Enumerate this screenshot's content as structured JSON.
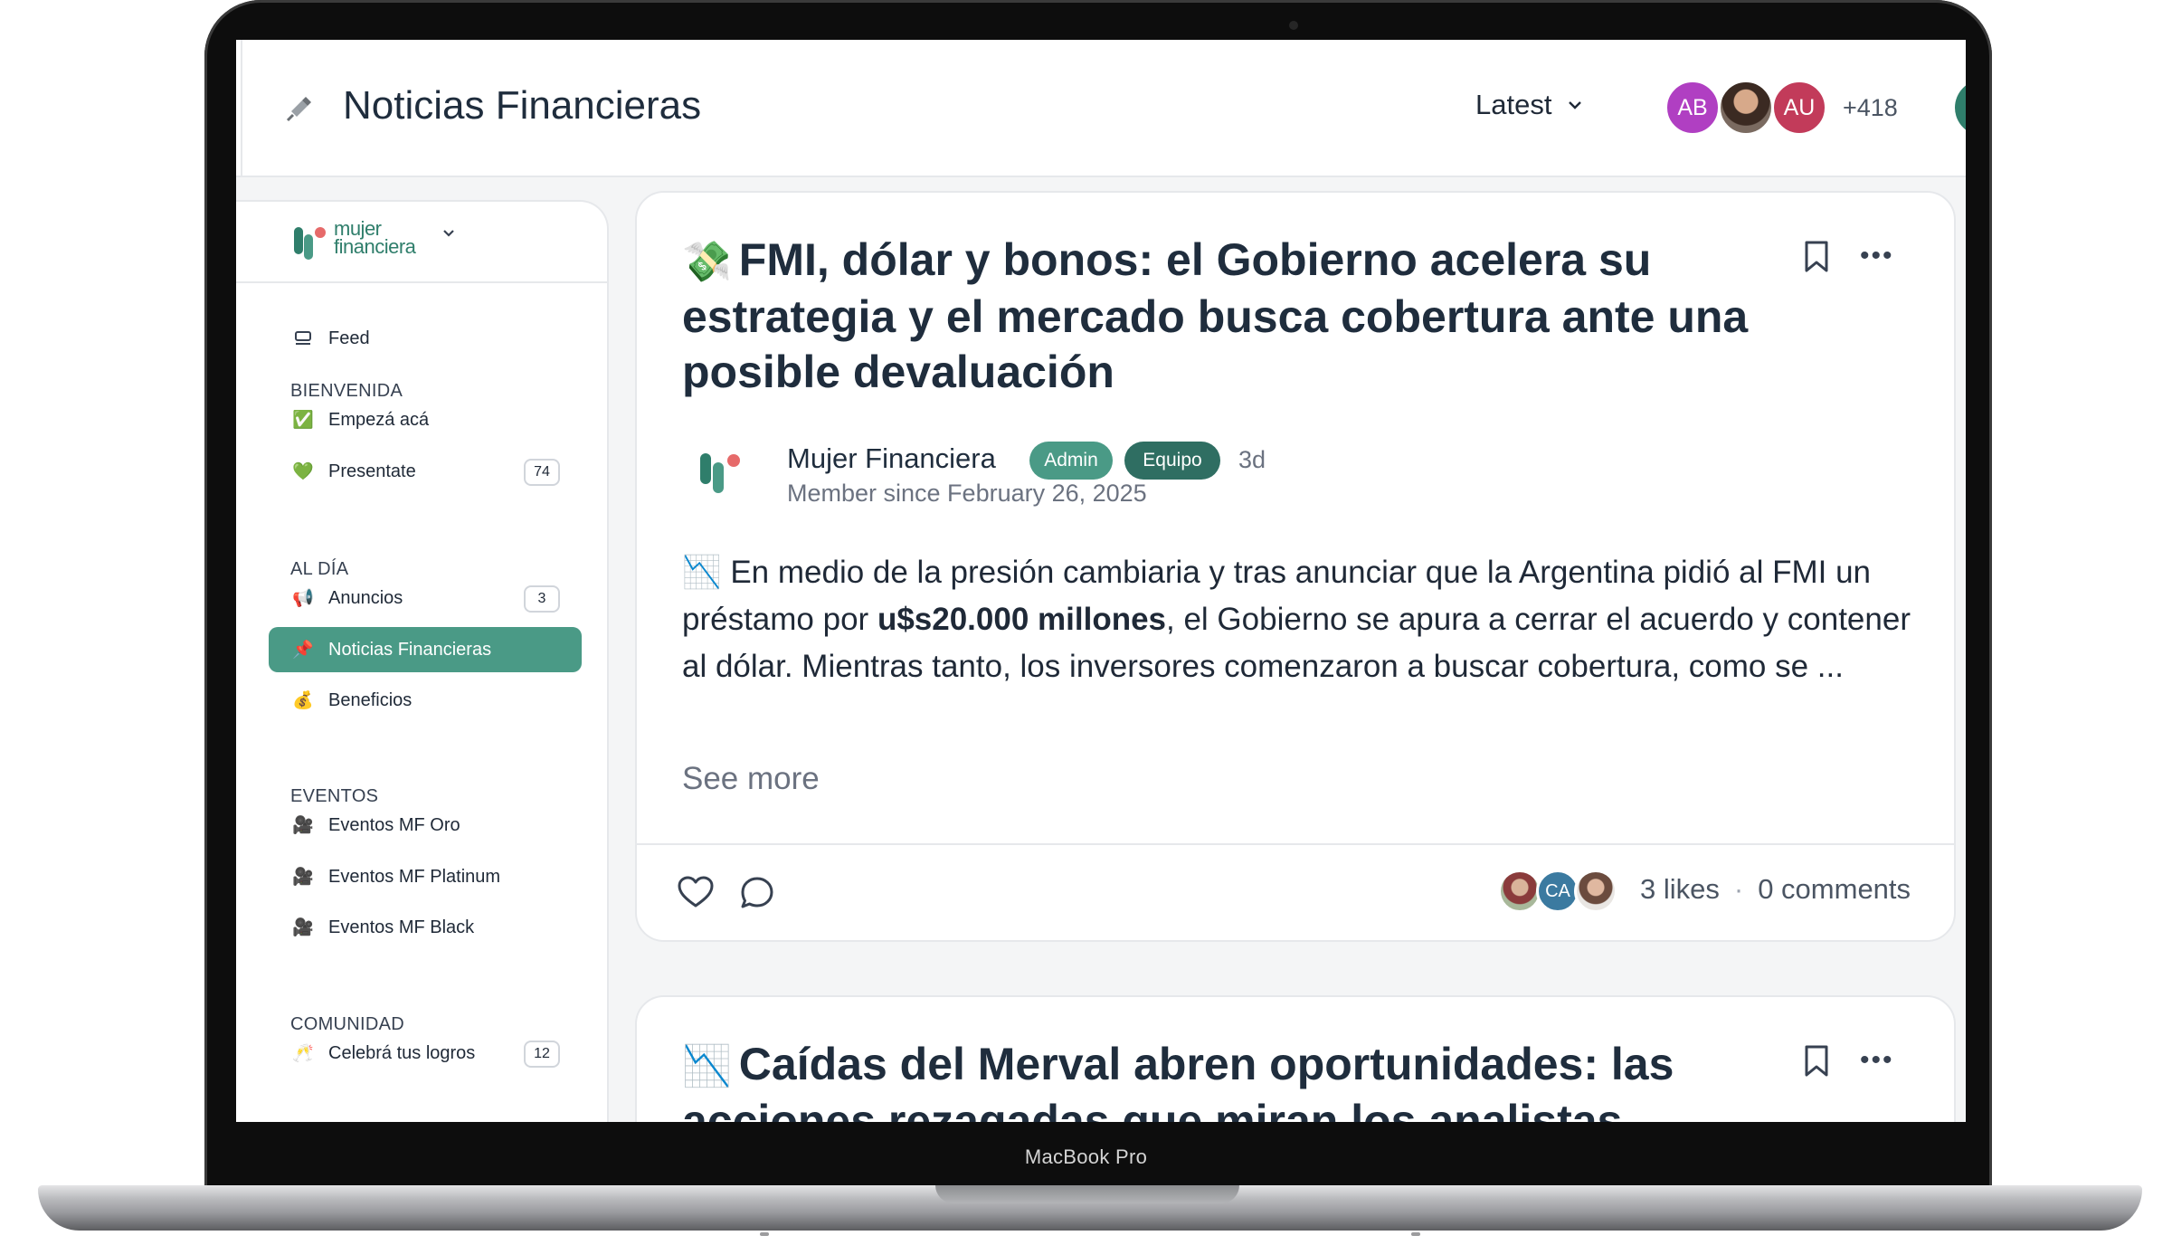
{
  "device": {
    "label": "MacBook Pro"
  },
  "header": {
    "title": "Noticias Financieras",
    "title_icon": "pushpin-icon",
    "sort": {
      "label": "Latest",
      "icon": "chevron-down-icon"
    },
    "avatars": [
      {
        "initials": "AB",
        "color": "#b03fc2"
      },
      {
        "initials": "",
        "photo": true
      },
      {
        "initials": "AU",
        "color": "#c23b5a"
      }
    ],
    "member_count": "+418"
  },
  "sidebar": {
    "brand": {
      "line1": "mujer",
      "line2": "financiera",
      "mark": "·"
    },
    "feed_label": "Feed",
    "sections": [
      {
        "label": "BIENVENIDA"
      },
      {
        "label": "AL DÍA"
      },
      {
        "label": "EVENTOS"
      },
      {
        "label": "COMUNIDAD"
      }
    ],
    "items": [
      {
        "icon": "✅",
        "label": "Empezá acá",
        "count": ""
      },
      {
        "icon": "💚",
        "label": "Presentate",
        "count": "74"
      },
      {
        "icon": "📢",
        "label": "Anuncios",
        "count": "3"
      },
      {
        "icon": "📌",
        "label": "Noticias Financieras",
        "count": "",
        "active": true
      },
      {
        "icon": "💰",
        "label": "Beneficios",
        "count": ""
      },
      {
        "icon": "🎥",
        "label": "Eventos MF Oro",
        "count": ""
      },
      {
        "icon": "🎥",
        "label": "Eventos MF Platinum",
        "count": ""
      },
      {
        "icon": "🎥",
        "label": "Eventos MF Black",
        "count": ""
      },
      {
        "icon": "🥂",
        "label": "Celebrá tus logros",
        "count": "12"
      }
    ],
    "accent_color": "#4a9a86"
  },
  "posts": [
    {
      "emoji": "💸",
      "title": "FMI, dólar y bonos: el Gobierno acelera su estrategia y el mercado busca cobertura ante una posible devaluación",
      "author": "Mujer Financiera",
      "badges": [
        "Admin",
        "Equipo"
      ],
      "age": "3d",
      "member_since": "Member since February 26, 2025",
      "body_emoji": "📉",
      "body_1": " En medio de la presión cambiaria y tras anunciar que la Argentina pidió al FMI un préstamo por ",
      "body_bold": "u$s20.000 millones",
      "body_2": ", el Gobierno se apura a cerrar el acuerdo y contener al dólar. Mientras tanto, los inversores comenzaron a buscar cobertura, como se ...",
      "see_more": "See more",
      "likers": [
        "",
        "CA",
        ""
      ],
      "likes": "3 likes",
      "separator": "·",
      "comments": "0 comments"
    },
    {
      "emoji": "📉",
      "title": "Caídas del Merval abren oportunidades: las acciones rezagadas que miran los analistas"
    }
  ]
}
